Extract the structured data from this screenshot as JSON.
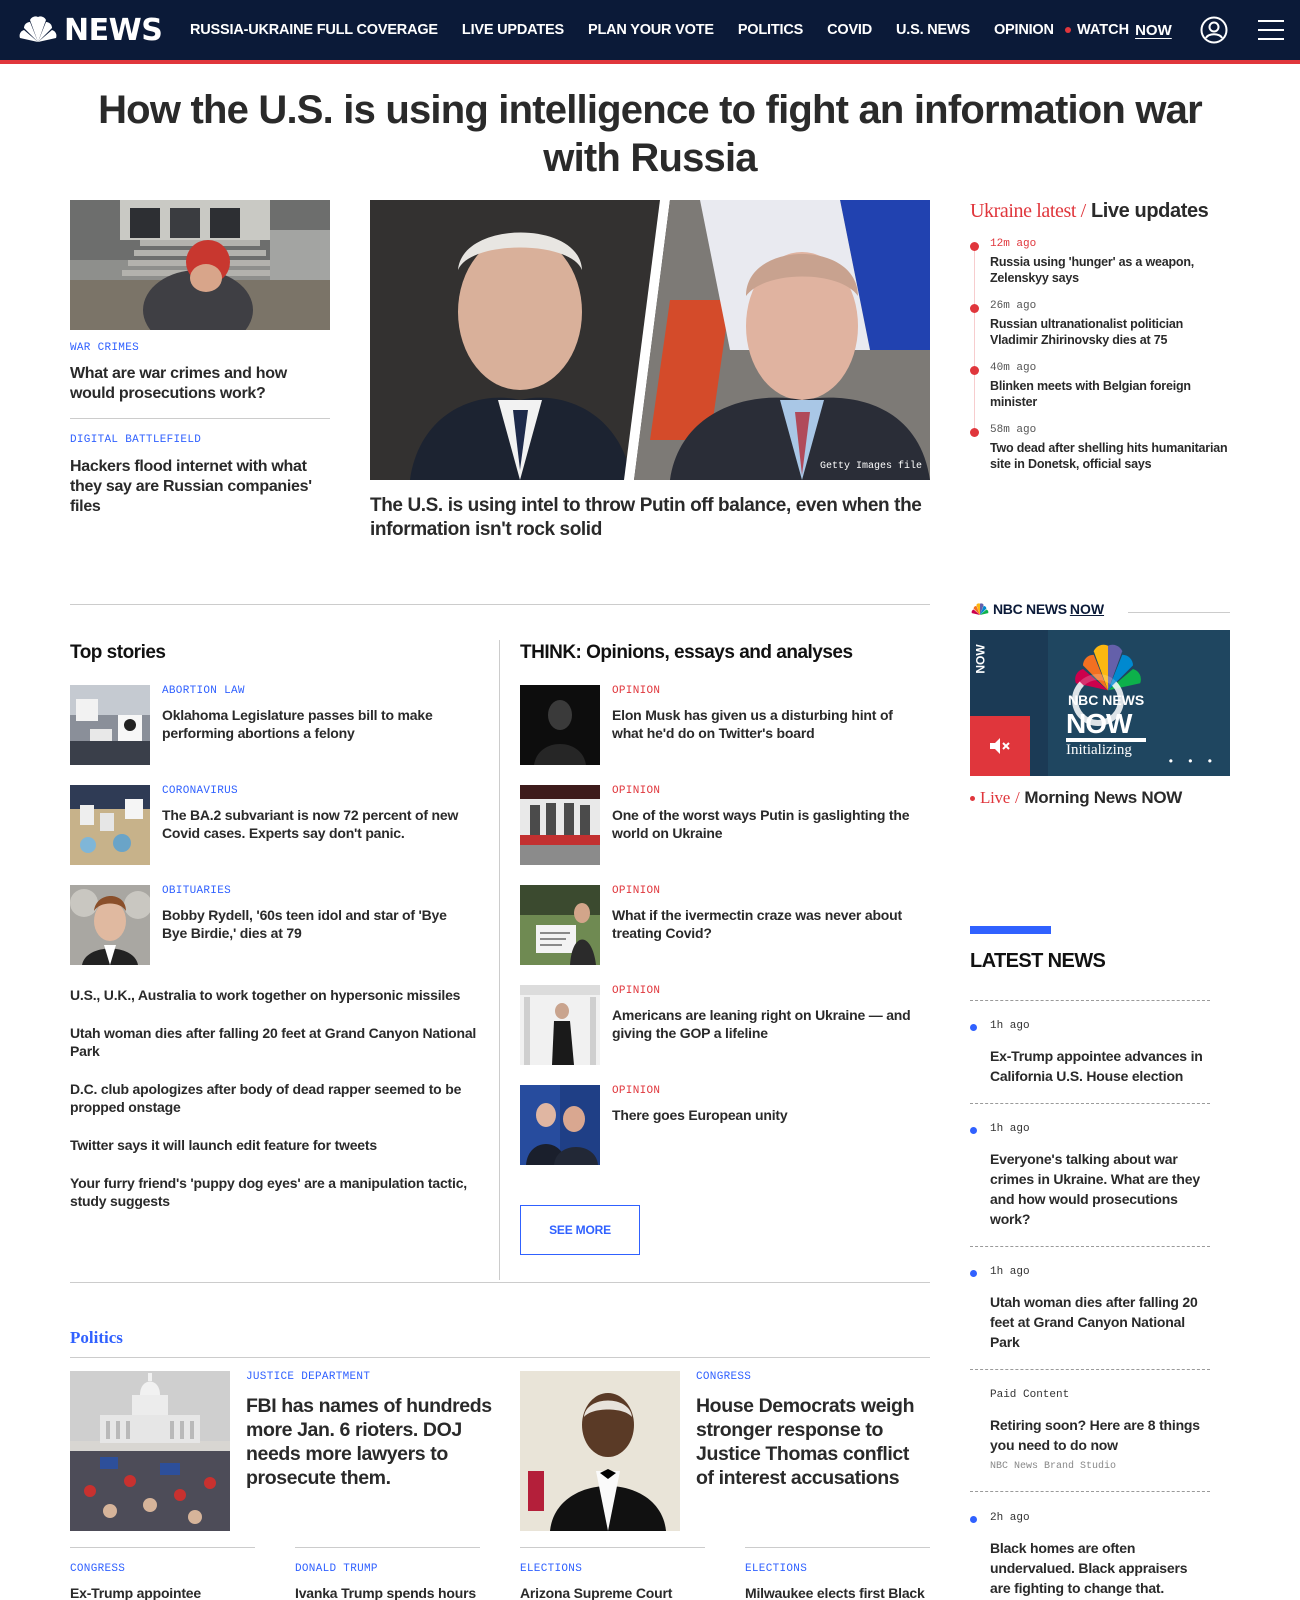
{
  "header": {
    "logo_text": "NEWS",
    "nav": [
      "RUSSIA-UKRAINE FULL COVERAGE",
      "LIVE UPDATES",
      "PLAN YOUR VOTE",
      "POLITICS",
      "COVID",
      "U.S. NEWS",
      "OPINION"
    ],
    "watch_label": "WATCH",
    "watch_now": "NOW",
    "icons": [
      "nbc-peacock-icon",
      "user-icon",
      "hamburger-menu-icon"
    ]
  },
  "headline": "How the U.S. is using intelligence to fight an information war with Russia",
  "left_rail": [
    {
      "kicker": "WAR CRIMES",
      "title": "What are war crimes and how would prosecutions work?"
    },
    {
      "kicker": "DIGITAL BATTLEFIELD",
      "title": "Hackers flood internet with what they say are Russian companies' files"
    }
  ],
  "hero": {
    "title": "The U.S. is using intel to throw Putin off balance, even when the information isn't rock solid",
    "credit": "Getty Images file"
  },
  "ukraine_live": {
    "label_a": "Ukraine latest /",
    "label_b": "Live updates",
    "items": [
      {
        "time": "12m ago",
        "text": "Russia using 'hunger' as a weapon, Zelenskyy says"
      },
      {
        "time": "26m ago",
        "text": "Russian ultranationalist politician Vladimir Zhirinovsky dies at 75"
      },
      {
        "time": "40m ago",
        "text": "Blinken meets with Belgian foreign minister"
      },
      {
        "time": "58m ago",
        "text": "Two dead after shelling hits humanitarian site in Donetsk, official says"
      }
    ]
  },
  "news_now": {
    "brand_a": "NBC NEWS",
    "brand_b": "NOW",
    "video_vertical": "NOW",
    "video_logo_l1": "NBC NEWS",
    "video_logo_l2": "NOW",
    "video_status": "Initializing",
    "video_dots": "• • •",
    "live_label": "Live",
    "live_sep": "/",
    "live_show": "Morning News NOW"
  },
  "top_stories": {
    "heading": "Top stories",
    "featured": [
      {
        "kicker": "ABORTION LAW",
        "title": "Oklahoma Legislature passes bill to make performing abortions a felony"
      },
      {
        "kicker": "CORONAVIRUS",
        "title": "The BA.2 subvariant is now 72 percent of new Covid cases. Experts say don't panic."
      },
      {
        "kicker": "OBITUARIES",
        "title": "Bobby Rydell, '60s teen idol and star of 'Bye Bye Birdie,' dies at 79"
      }
    ],
    "more": [
      "U.S., U.K., Australia to work together on hypersonic missiles",
      "Utah woman dies after falling 20 feet at Grand Canyon National Park",
      "D.C. club apologizes after body of dead rapper seemed to be propped onstage",
      "Twitter says it will launch edit feature for tweets",
      "Your furry friend's 'puppy dog eyes' are a manipulation tactic, study suggests"
    ]
  },
  "think": {
    "heading": "THINK: Opinions, essays and analyses",
    "items": [
      {
        "kicker": "OPINION",
        "title": "Elon Musk has given us a disturbing hint of what he'd do on Twitter's board"
      },
      {
        "kicker": "OPINION",
        "title": "One of the worst ways Putin is gaslighting the world on Ukraine"
      },
      {
        "kicker": "OPINION",
        "title": "What if the ivermectin craze was never about treating Covid?"
      },
      {
        "kicker": "OPINION",
        "title": "Americans are leaning right on Ukraine — and giving the GOP a lifeline"
      },
      {
        "kicker": "OPINION",
        "title": "There goes European unity"
      }
    ],
    "see_more": "SEE MORE"
  },
  "latest_news": {
    "heading": "LATEST NEWS",
    "items": [
      {
        "time": "1h ago",
        "text": "Ex-Trump appointee advances in California U.S. House election"
      },
      {
        "time": "1h ago",
        "text": "Everyone's talking about war crimes in Ukraine. What are they and how would prosecutions work?"
      },
      {
        "time": "1h ago",
        "text": "Utah woman dies after falling 20 feet at Grand Canyon National Park"
      },
      {
        "time": "Paid Content",
        "text": "Retiring soon? Here are 8 things you need to do now",
        "sponsor": "NBC News Brand Studio"
      },
      {
        "time": "2h ago",
        "text": "Black homes are often undervalued. Black appraisers are fighting to change that."
      }
    ]
  },
  "politics": {
    "heading": "Politics",
    "big": [
      {
        "kicker": "JUSTICE DEPARTMENT",
        "title": "FBI has names of hundreds more Jan. 6 rioters. DOJ needs more lawyers to prosecute them."
      },
      {
        "kicker": "CONGRESS",
        "title": "House Democrats weigh stronger response to Justice Thomas conflict of interest accusations"
      }
    ],
    "small": [
      {
        "kicker": "CONGRESS",
        "title": "Ex-Trump appointee"
      },
      {
        "kicker": "DONALD TRUMP",
        "title": "Ivanka Trump spends hours"
      },
      {
        "kicker": "ELECTIONS",
        "title": "Arizona Supreme Court"
      },
      {
        "kicker": "ELECTIONS",
        "title": "Milwaukee elects first Black"
      }
    ]
  },
  "colors": {
    "nav_bg": "#0b1a38",
    "accent_red": "#e0363c",
    "accent_blue": "#3061ff"
  }
}
